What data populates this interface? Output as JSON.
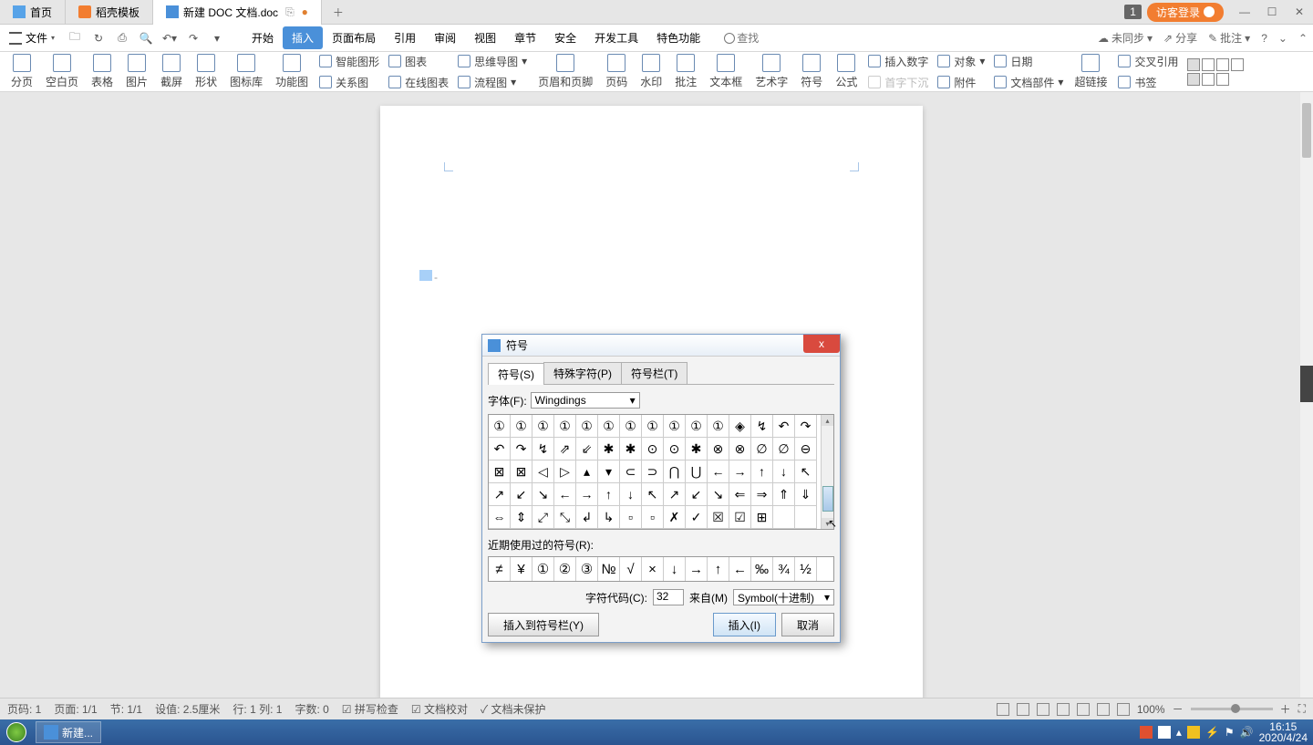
{
  "tabs": {
    "home": "首页",
    "templates": "稻壳模板",
    "doc": "新建 DOC 文档.doc"
  },
  "winbadge": "1",
  "login": "访客登录",
  "file_menu": "文件",
  "menu_tabs": [
    "开始",
    "插入",
    "页面布局",
    "引用",
    "审阅",
    "视图",
    "章节",
    "安全",
    "开发工具",
    "特色功能"
  ],
  "active_menu_tab": 1,
  "search_hint": "查找",
  "top_right": {
    "sync": "未同步",
    "share": "分享",
    "approve": "批注"
  },
  "ribbon": {
    "r1": "分页",
    "r2": "空白页",
    "r3": "表格",
    "r4": "图片",
    "r5": "截屏",
    "r6": "形状",
    "r7": "图标库",
    "r8": "功能图",
    "s1": "智能图形",
    "s2": "图表",
    "s3": "思维导图",
    "s4": "关系图",
    "s5": "在线图表",
    "s6": "流程图",
    "r9": "页眉和页脚",
    "r10": "页码",
    "r11": "水印",
    "r12": "批注",
    "r13": "文本框",
    "r14": "艺术字",
    "r15": "符号",
    "r16": "公式",
    "s7": "插入数字",
    "s8": "对象",
    "s9": "日期",
    "s10": "首字下沉",
    "s11": "附件",
    "s12": "文档部件",
    "r17": "超链接",
    "r18": "书签",
    "s13": "交叉引用"
  },
  "dialog": {
    "title": "符号",
    "tabs": [
      "符号(S)",
      "特殊字符(P)",
      "符号栏(T)"
    ],
    "font_label": "字体(F):",
    "font_value": "Wingdings",
    "symbols_rows": [
      [
        "①",
        "①",
        "①",
        "①",
        "①",
        "①",
        "①",
        "①",
        "①",
        "①",
        "①",
        "◈",
        "↯",
        "↶",
        "↷"
      ],
      [
        "↶",
        "↷",
        "↯",
        "⇗",
        "⇙",
        "✱",
        "✱",
        "⊙",
        "⊙",
        "✱",
        "⊗",
        "⊗",
        "∅",
        "∅",
        "⊖"
      ],
      [
        "⊠",
        "⊠",
        "◁",
        "▷",
        "▴",
        "▾",
        "⊂",
        "⊃",
        "⋂",
        "⋃",
        "←",
        "→",
        "↑",
        "↓",
        "↖"
      ],
      [
        "↗",
        "↙",
        "↘",
        "←",
        "→",
        "↑",
        "↓",
        "↖",
        "↗",
        "↙",
        "↘",
        "⇐",
        "⇒",
        "⇑",
        "⇓"
      ],
      [
        "⇔",
        "⇕",
        "⤢",
        "⤡",
        "↲",
        "↳",
        "▫",
        "▫",
        "✗",
        "✓",
        "☒",
        "☑",
        "⊞",
        "",
        ""
      ]
    ],
    "recent_label": "近期使用过的符号(R):",
    "recent": [
      "≠",
      "¥",
      "①",
      "②",
      "③",
      "№",
      "√",
      "×",
      "↓",
      "→",
      "↑",
      "←",
      "‰",
      "¾",
      "½"
    ],
    "code_label": "字符代码(C):",
    "code_value": "32",
    "from_label": "来自(M)",
    "from_value": "Symbol(十进制)",
    "btn_insert_bar": "插入到符号栏(Y)",
    "btn_insert": "插入(I)",
    "btn_cancel": "取消"
  },
  "statusbar": {
    "page": "页码: 1",
    "pages": "页面: 1/1",
    "section": "节: 1/1",
    "setting": "设值: 2.5厘米",
    "row": "行: 1  列: 1",
    "chars": "字数: 0",
    "spell": "拼写检查",
    "proof": "文档校对",
    "protect": "文档未保护",
    "zoom": "100%"
  },
  "taskbar": {
    "app": "新建...",
    "time": "16:15",
    "date": "2020/4/24"
  }
}
